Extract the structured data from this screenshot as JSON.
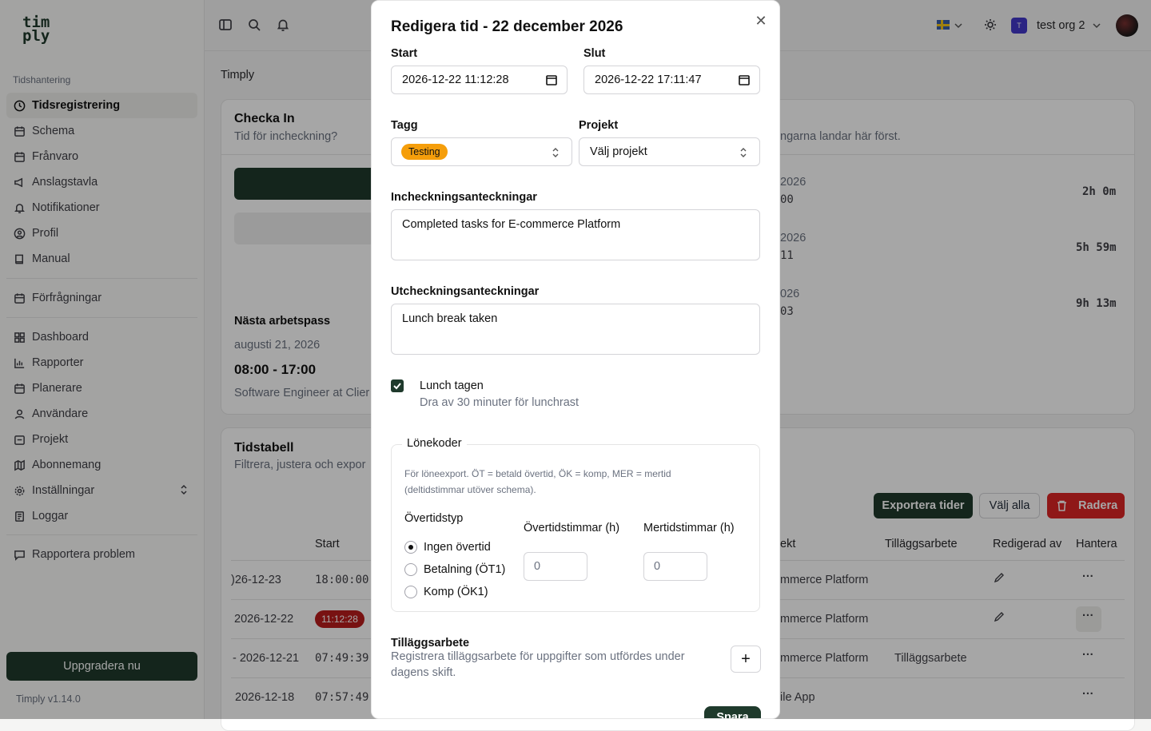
{
  "sidebar": {
    "logo_line1": "tim",
    "logo_line2": "ply",
    "section_label": "Tidshantering",
    "items": [
      {
        "label": "Tidsregistrering"
      },
      {
        "label": "Schema"
      },
      {
        "label": "Frånvaro"
      },
      {
        "label": "Anslagstavla"
      },
      {
        "label": "Notifikationer"
      },
      {
        "label": "Profil"
      },
      {
        "label": "Manual"
      },
      {
        "label": "Förfrågningar"
      },
      {
        "label": "Dashboard"
      },
      {
        "label": "Rapporter"
      },
      {
        "label": "Planerare"
      },
      {
        "label": "Användare"
      },
      {
        "label": "Projekt"
      },
      {
        "label": "Abonnemang"
      },
      {
        "label": "Inställningar"
      },
      {
        "label": "Loggar"
      },
      {
        "label": "Rapportera problem"
      }
    ],
    "upgrade_label": "Uppgradera nu",
    "version": "Timply v1.14.0"
  },
  "topbar": {
    "org_name": "test org 2",
    "org_initial": "T"
  },
  "breadcrumb": "Timply",
  "checkin_card": {
    "title": "Checka In",
    "subtitle": "Tid för incheckning?",
    "right_subtitle": "ngarna landar här först.",
    "next_shift_title": "Nästa arbetspass",
    "next_shift_date": "augusti 21, 2026",
    "next_shift_time": "08:00 - 17:00",
    "next_shift_role": "Software Engineer at Clier",
    "recent": [
      {
        "date": "2026",
        "time": "00",
        "duration": "2h 0m"
      },
      {
        "date": "2026",
        "time": "11",
        "duration": "5h 59m"
      },
      {
        "date": "026",
        "time": "03",
        "duration": "9h 13m"
      }
    ]
  },
  "timetable": {
    "title": "Tidstabell",
    "subtitle": "Filtrera, justera och expor",
    "export_label": "Exportera tider",
    "select_all_label": "Välj alla",
    "delete_label": "Radera",
    "headers": {
      "start": "Start",
      "project": "ekt",
      "extra": "Tilläggsarbete",
      "edited_by": "Redigerad av",
      "manage": "Hantera"
    },
    "rows": [
      {
        "date": ")26-12-23",
        "start": "18:00:00",
        "project": "mmerce Platform",
        "extra": ""
      },
      {
        "date": "2026-12-22",
        "start": "11:12:28",
        "project": "mmerce Platform",
        "extra": ""
      },
      {
        "date": "- 2026-12-21",
        "start": "07:49:39",
        "project": "mmerce Platform",
        "extra": "Tilläggsarbete"
      },
      {
        "date": "2026-12-18",
        "start": "07:57:49",
        "project": "ile App",
        "extra": ""
      }
    ],
    "more_glyph": "···"
  },
  "modal": {
    "title": "Redigera tid - 22 december 2026",
    "start_label": "Start",
    "start_value": "2026-12-22 11:12:28",
    "end_label": "Slut",
    "end_value": "2026-12-22 17:11:47",
    "tag_label": "Tagg",
    "tag_value": "Testing",
    "project_label": "Projekt",
    "project_value": "Välj projekt",
    "checkin_notes_label": "Incheckningsanteckningar",
    "checkin_notes_value": "Completed tasks for E-commerce Platform",
    "checkout_notes_label": "Utcheckningsanteckningar",
    "checkout_notes_value": "Lunch break taken",
    "lunch_label": "Lunch tagen",
    "lunch_desc": "Dra av 30 minuter för lunchrast",
    "pay_codes_legend": "Lönekoder",
    "pay_codes_desc_1": "För löneexport. ÖT = betald övertid, ÖK = komp, MER = mertid",
    "pay_codes_desc_2": "(deltidstimmar utöver schema).",
    "overtime_type_label": "Övertidstyp",
    "overtime_hours_label": "Övertidstimmar (h)",
    "extra_hours_label": "Mertidstimmar (h)",
    "radio_options": [
      "Ingen övertid",
      "Betalning (ÖT1)",
      "Komp (ÖK1)"
    ],
    "overtime_hours_value": "0",
    "extra_hours_value": "0",
    "extra_work_title": "Tilläggsarbete",
    "extra_work_desc_1": "Registrera tilläggsarbete för uppgifter som utfördes under",
    "extra_work_desc_2": "dagens skift.",
    "save_label": "Spara"
  },
  "colors": {
    "brand": "#1f3a2c",
    "tag": "#f59e0b",
    "danger": "#dc2626"
  }
}
